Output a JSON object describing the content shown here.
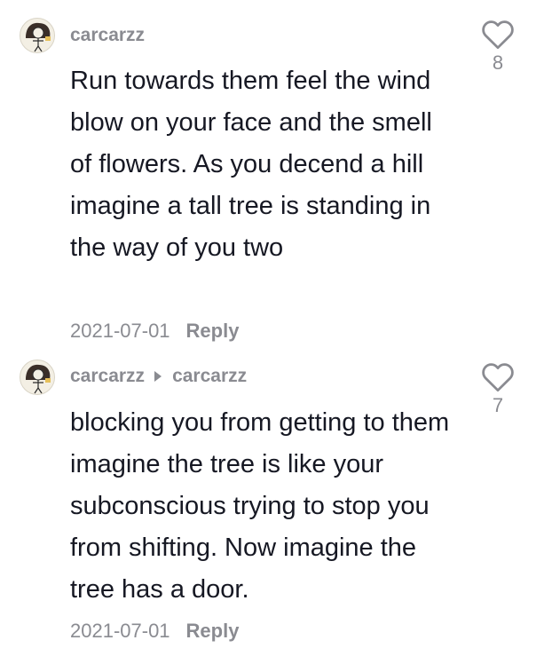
{
  "comments": [
    {
      "username": "carcarzz",
      "text": "Run towards them feel the wind blow on your face and the smell of flowers. As you decend a hill imagine a tall tree is standing in the way of you two",
      "date": "2021-07-01",
      "reply_label": "Reply",
      "like_count": "8",
      "avatar_icon": "stick-figure-avatar"
    },
    {
      "username": "carcarzz",
      "reply_to": "carcarzz",
      "text": "blocking you from getting to them imagine the tree is like your subconscious trying to stop you from shifting. Now imagine the tree has a door.",
      "date": "2021-07-01",
      "reply_label": "Reply",
      "like_count": "7",
      "avatar_icon": "stick-figure-avatar"
    }
  ],
  "colors": {
    "text": "#161823",
    "muted": "#8a8b91"
  },
  "icons": {
    "like": "heart-outline-icon",
    "reply_arrow": "right-triangle-icon"
  }
}
